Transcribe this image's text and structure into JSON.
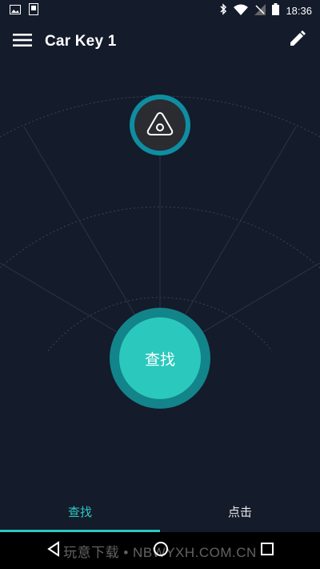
{
  "status_bar": {
    "time": "18:36",
    "left_icons": [
      "image-icon",
      "sim-icon"
    ],
    "right_icons": [
      "bluetooth-icon",
      "wifi-icon",
      "no-signal-icon",
      "battery-icon"
    ]
  },
  "app_bar": {
    "title": "Car Key 1",
    "menu_icon": "hamburger-menu-icon",
    "edit_icon": "pencil-icon"
  },
  "device": {
    "icon": "triangle-tag-icon",
    "ring_color": "#0e8ea0"
  },
  "find_button": {
    "label": "查找",
    "color": "#2bc8bd"
  },
  "tabs": [
    {
      "label": "查找",
      "active": true
    },
    {
      "label": "点击",
      "active": false
    }
  ],
  "nav_bar": {
    "buttons": [
      "back-icon",
      "home-icon",
      "recents-icon"
    ]
  },
  "watermark": "玩意下载 • NBWYXH.COM.CN",
  "colors": {
    "background": "#141b2b",
    "accent": "#2bc8bd",
    "accent_dark": "#12848a"
  }
}
